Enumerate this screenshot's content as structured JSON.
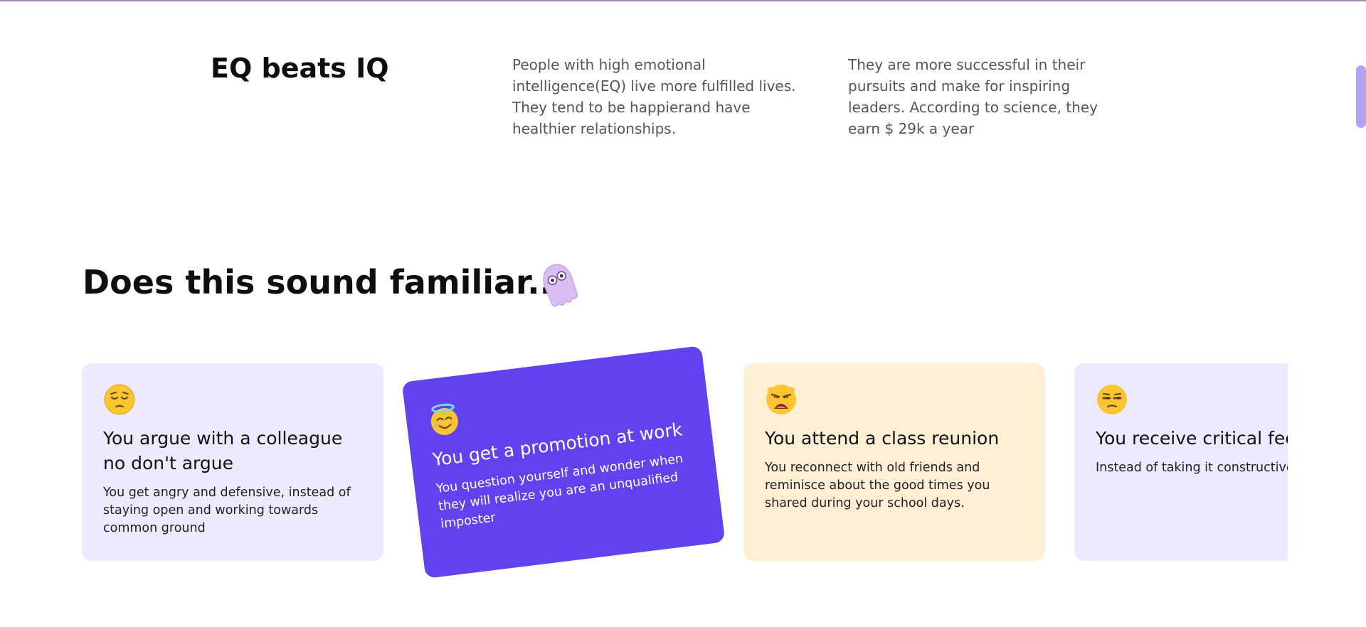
{
  "intro": {
    "title": "EQ beats IQ",
    "col1": "People with high emotional intelligence(EQ) live more fulfilled lives. They tend to be happierand have healthier relationships.",
    "col2": "They are more successful in their pursuits and make for inspiring leaders. According to science, they earn $ 29k a year"
  },
  "section": {
    "title": "Does this sound familiar..."
  },
  "cards": [
    {
      "emoji": "pensive-face-icon",
      "title": "You argue with a colleague no don't argue",
      "text": "You get angry and defensive, instead of staying open and working towards common ground"
    },
    {
      "emoji": "halo-face-icon",
      "title": "You get a promotion at work",
      "text": "You question yourself and wonder when they will realize you are an unqualified imposter"
    },
    {
      "emoji": "distraught-face-icon",
      "title": "You attend a class reunion",
      "text": "You reconnect with old friends and reminisce about the good times you shared during your school days."
    },
    {
      "emoji": "unamused-face-icon",
      "title": "You receive critical feedback",
      "text": "Instead of taking it constructively, you become defensive and dismissive, hindering personal growth."
    }
  ],
  "colors": {
    "accent": "#6142ee",
    "card_lavender": "#ede9fe",
    "card_cream": "#feefd5",
    "scroll_thumb": "#b3a2f2"
  }
}
